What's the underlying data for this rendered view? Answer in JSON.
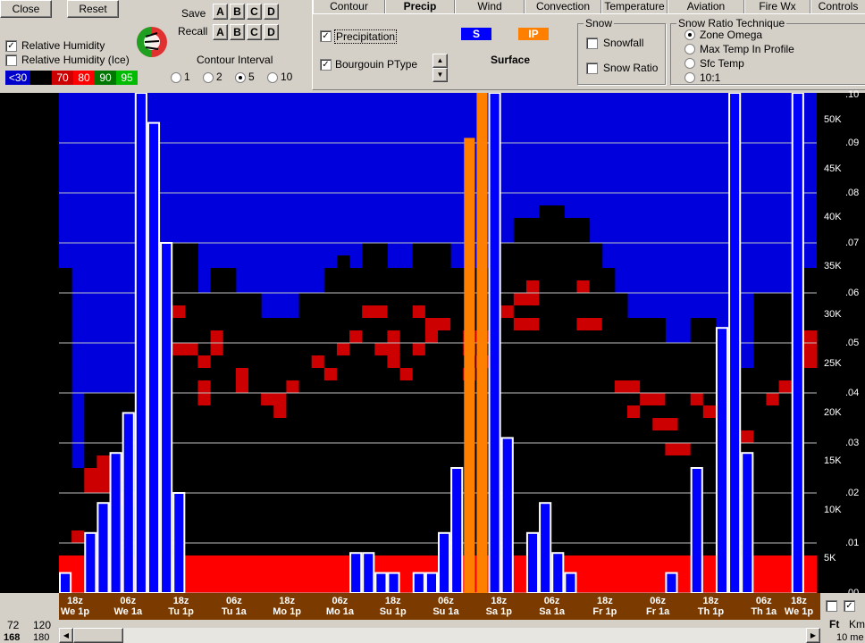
{
  "toolbar": {
    "close_label": "Close",
    "reset_label": "Reset",
    "save_label": "Save",
    "recall_label": "Recall",
    "slots": [
      "A",
      "B",
      "C",
      "D"
    ]
  },
  "humidity": {
    "rh_label": "Relative Humidity",
    "rh_checked": true,
    "rh_ice_label": "Relative Humidity (Ice)",
    "rh_ice_checked": false,
    "legend": [
      {
        "label": "<30",
        "color": "#0000cc"
      },
      {
        "label": "",
        "color": "#000000"
      },
      {
        "label": "70",
        "color": "#cc0000"
      },
      {
        "label": "80",
        "color": "#ff0000"
      },
      {
        "label": "90",
        "color": "#007700"
      },
      {
        "label": "95",
        "color": "#00cc00"
      }
    ]
  },
  "contour": {
    "title": "Contour Interval",
    "options": [
      "1",
      "2",
      "5",
      "10"
    ],
    "selected": "5"
  },
  "tabs": [
    {
      "label": "Contour",
      "active": false
    },
    {
      "label": "Precip",
      "active": true
    },
    {
      "label": "Wind",
      "active": false
    },
    {
      "label": "Convection",
      "active": false
    },
    {
      "label": "Temperature",
      "active": false
    },
    {
      "label": "Aviation",
      "active": false
    },
    {
      "label": "Fire Wx",
      "active": false
    },
    {
      "label": "Controls",
      "active": false
    }
  ],
  "precip": {
    "precipitation_label": "Precipitation",
    "precipitation_checked": true,
    "bourgouin_label": "Bourgouin PType",
    "bourgouin_checked": true,
    "badge_s": "S",
    "badge_ip": "IP",
    "level_label": "Surface"
  },
  "snow": {
    "title": "Snow",
    "snowfall_label": "Snowfall",
    "snow_ratio_label": "Snow Ratio"
  },
  "snow_ratio": {
    "title": "Snow Ratio Technique",
    "options": [
      "Zone Omega",
      "Max Temp In Profile",
      "Sfc Temp",
      "10:1"
    ],
    "selected": "Zone Omega"
  },
  "bottom": {
    "left_top": [
      "72",
      "120"
    ],
    "left_bottom": [
      "168",
      "180"
    ],
    "unit_ft": "Ft",
    "unit_km": "Km",
    "right_note": "10 me"
  },
  "colors": {
    "snow": "#0000ff",
    "ip": "#ff8000",
    "time_bar": "#7a3a00",
    "rh_blue": "#0000dd",
    "rh_black": "#000000",
    "rh_red_dark": "#cc0000",
    "rh_red": "#ff0000",
    "rh_green_dark": "#007700",
    "rh_green": "#00dd00"
  },
  "chart_data": {
    "type": "bar",
    "x_ticks_top": [
      "18z",
      "06z",
      "18z",
      "06z",
      "18z",
      "06z",
      "18z",
      "06z",
      "18z",
      "06z",
      "18z",
      "06z",
      "18z",
      "06z",
      "18z"
    ],
    "x_ticks_bottom": [
      "We 1p",
      "We 1a",
      "Tu 1p",
      "Tu 1a",
      "Mo 1p",
      "Mo 1a",
      "Su 1p",
      "Su 1a",
      "Sa 1p",
      "Sa 1a",
      "Fr 1p",
      "Fr 1a",
      "Th 1p",
      "Th 1a",
      "We 1p"
    ],
    "height_labels": [
      "50K",
      "45K",
      "40K",
      "35K",
      "30K",
      "25K",
      "20K",
      "15K",
      "10K",
      "5K"
    ],
    "precip_labels": [
      ".10",
      ".09",
      ".08",
      ".07",
      ".06",
      ".05",
      ".04",
      ".03",
      ".02",
      ".01",
      ".00"
    ],
    "ylim": [
      0,
      0.1
    ],
    "precip_bars": [
      {
        "type": "S",
        "value": 0.004
      },
      {
        "type": "S",
        "value": 0.0
      },
      {
        "type": "S",
        "value": 0.012
      },
      {
        "type": "S",
        "value": 0.018
      },
      {
        "type": "S",
        "value": 0.028
      },
      {
        "type": "S",
        "value": 0.036
      },
      {
        "type": "S",
        "value": 0.1
      },
      {
        "type": "S",
        "value": 0.094
      },
      {
        "type": "S",
        "value": 0.07
      },
      {
        "type": "S",
        "value": 0.02
      },
      {
        "type": "S",
        "value": 0.0
      },
      {
        "type": "S",
        "value": 0.0
      },
      {
        "type": "S",
        "value": 0.0
      },
      {
        "type": "S",
        "value": 0.0
      },
      {
        "type": "S",
        "value": 0.0
      },
      {
        "type": "S",
        "value": 0.0
      },
      {
        "type": "S",
        "value": 0.0
      },
      {
        "type": "S",
        "value": 0.0
      },
      {
        "type": "S",
        "value": 0.0
      },
      {
        "type": "S",
        "value": 0.0
      },
      {
        "type": "S",
        "value": 0.0
      },
      {
        "type": "S",
        "value": 0.0
      },
      {
        "type": "S",
        "value": 0.0
      },
      {
        "type": "S",
        "value": 0.008
      },
      {
        "type": "S",
        "value": 0.008
      },
      {
        "type": "S",
        "value": 0.004
      },
      {
        "type": "S",
        "value": 0.004
      },
      {
        "type": "S",
        "value": 0.0
      },
      {
        "type": "S",
        "value": 0.004
      },
      {
        "type": "S",
        "value": 0.004
      },
      {
        "type": "S",
        "value": 0.012
      },
      {
        "type": "S",
        "value": 0.025
      },
      {
        "type": "IP",
        "value": 0.091
      },
      {
        "type": "IP",
        "value": 0.1
      },
      {
        "type": "S",
        "value": 0.1
      },
      {
        "type": "S",
        "value": 0.031
      },
      {
        "type": "S",
        "value": 0.0
      },
      {
        "type": "S",
        "value": 0.012
      },
      {
        "type": "S",
        "value": 0.018
      },
      {
        "type": "S",
        "value": 0.008
      },
      {
        "type": "S",
        "value": 0.004
      },
      {
        "type": "S",
        "value": 0.0
      },
      {
        "type": "S",
        "value": 0.0
      },
      {
        "type": "S",
        "value": 0.0
      },
      {
        "type": "S",
        "value": 0.0
      },
      {
        "type": "S",
        "value": 0.0
      },
      {
        "type": "S",
        "value": 0.0
      },
      {
        "type": "S",
        "value": 0.0
      },
      {
        "type": "S",
        "value": 0.004
      },
      {
        "type": "S",
        "value": 0.0
      },
      {
        "type": "S",
        "value": 0.025
      },
      {
        "type": "S",
        "value": 0.0
      },
      {
        "type": "S",
        "value": 0.053
      },
      {
        "type": "S",
        "value": 0.1
      },
      {
        "type": "S",
        "value": 0.028
      },
      {
        "type": "S",
        "value": 0.0
      },
      {
        "type": "S",
        "value": 0.0
      },
      {
        "type": "S",
        "value": 0.0
      },
      {
        "type": "S",
        "value": 0.1
      },
      {
        "type": "S",
        "value": 0.0
      }
    ]
  }
}
